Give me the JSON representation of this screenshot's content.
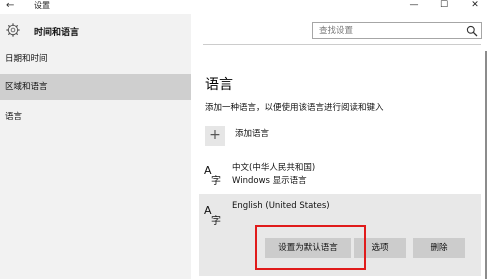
{
  "titlebar": {
    "back_glyph": "←",
    "title": "设置",
    "minimize_glyph": "—",
    "maximize_glyph": "☐",
    "close_glyph": "✕"
  },
  "left": {
    "header": "时间和语言",
    "icon": "gear-icon",
    "nav": [
      {
        "label": "日期和时间",
        "selected": false
      },
      {
        "label": "区域和语言",
        "selected": true
      },
      {
        "label": "语言",
        "selected": false
      }
    ]
  },
  "search": {
    "placeholder": "查找设置",
    "icon": "search-icon"
  },
  "main": {
    "section_title": "语言",
    "description": "添加一种语言，以便使用该语言进行阅读和键入",
    "add_language_label": "添加语言",
    "add_glyph": "+",
    "languages": [
      {
        "name": "中文(中华人民共和国)",
        "subtitle": "Windows 显示语言"
      },
      {
        "name": "English (United States)",
        "subtitle": ""
      }
    ],
    "buttons": {
      "set_default": "设置为默认语言",
      "options": "选项",
      "remove": "删除"
    }
  },
  "colors": {
    "highlight": "#e01b1b",
    "selected_nav": "#cfcfcf",
    "left_bg": "#f2f2f2",
    "button_bg": "#cccccc"
  }
}
